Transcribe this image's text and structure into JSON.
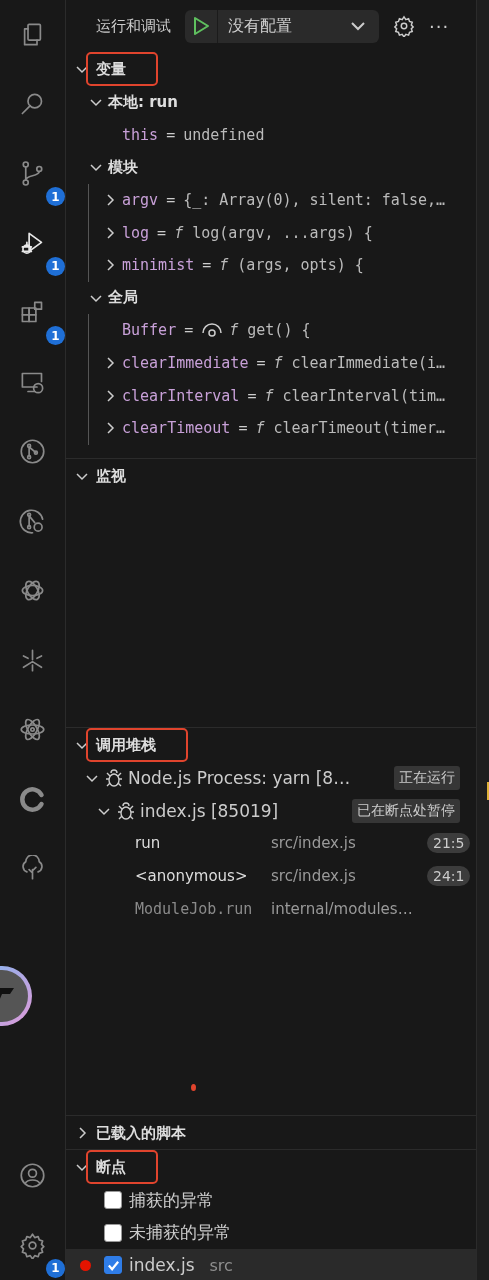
{
  "activity_bar": {
    "items": [
      {
        "selected": false
      },
      {
        "selected": false
      },
      {
        "selected": false,
        "badge": "1"
      },
      {
        "selected": true,
        "badge": "1"
      },
      {
        "selected": false,
        "badge": "1"
      },
      {
        "selected": false
      },
      {
        "selected": false
      },
      {
        "selected": false
      },
      {
        "selected": false
      },
      {
        "selected": false
      },
      {
        "selected": false
      },
      {
        "selected": false
      },
      {
        "selected": false
      }
    ],
    "bottom": [
      {
        "selected": false
      },
      {
        "selected": false,
        "badge": "1"
      }
    ]
  },
  "header": {
    "title": "运行和调试",
    "configuration": "没有配置",
    "more": "···"
  },
  "variables": {
    "title": "变量",
    "expanded": true,
    "annotated": true,
    "scopes": [
      {
        "label": "本地: run",
        "expanded": true,
        "children": [
          {
            "kind": "leaf",
            "name": "this",
            "operator": "=",
            "value": "undefined"
          }
        ]
      },
      {
        "label": "模块",
        "expanded": true,
        "children": [
          {
            "kind": "expandable",
            "name": "argv",
            "operator": "=",
            "value": "{_: Array(0), silent: false,…"
          },
          {
            "kind": "expandable",
            "name": "log",
            "operator": "=",
            "value": "*f* log(argv, ...args) {"
          },
          {
            "kind": "expandable",
            "name": "minimist",
            "operator": "=",
            "value": "*f* (args, opts) {"
          }
        ]
      },
      {
        "label": "全局",
        "expanded": true,
        "children": [
          {
            "kind": "getter",
            "name": "Buffer",
            "operator": "=",
            "value": "*f* get() {"
          },
          {
            "kind": "expandable",
            "name": "clearImmediate",
            "operator": "=",
            "value": "*f* clearImmediate(i…"
          },
          {
            "kind": "expandable",
            "name": "clearInterval",
            "operator": "=",
            "value": "*f* clearInterval(tim…"
          },
          {
            "kind": "expandable",
            "name": "clearTimeout",
            "operator": "=",
            "value": "*f* clearTimeout(timer…"
          }
        ]
      }
    ]
  },
  "watch": {
    "title": "监视",
    "expanded": true,
    "annotated": false
  },
  "call_stack": {
    "title": "调用堆栈",
    "expanded": true,
    "annotated": true,
    "sessions": [
      {
        "label": "Node.js Process: yarn [8…",
        "status": "正在运行",
        "expanded": true,
        "children": [
          {
            "label": "index.js [85019]",
            "status": "已在断点处暂停",
            "expanded": true,
            "frames": [
              {
                "name": "run",
                "file": "src/index.js",
                "position": "21:5",
                "dimmed": false
              },
              {
                "name": "<anonymous>",
                "file": "src/index.js",
                "position": "24:1",
                "dimmed": false
              },
              {
                "name": "ModuleJob.run",
                "file": "internal/modules…",
                "dimmed": true
              }
            ]
          }
        ]
      }
    ]
  },
  "loaded_scripts": {
    "title": "已载入的脚本",
    "expanded": false,
    "annotated": false
  },
  "breakpoints": {
    "title": "断点",
    "expanded": true,
    "annotated": true,
    "items": [
      {
        "kind": "exception",
        "label": "捕获的异常",
        "checked": false,
        "selected": false
      },
      {
        "kind": "exception",
        "label": "未捕获的异常",
        "checked": false,
        "selected": false
      },
      {
        "kind": "file",
        "label": "index.js",
        "path": "src",
        "checked": true,
        "selected": true
      }
    ]
  }
}
